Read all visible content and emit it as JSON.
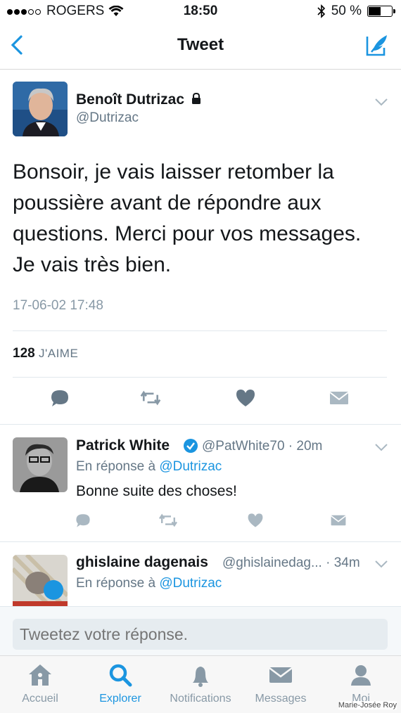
{
  "status_bar": {
    "carrier": "ROGERS",
    "time": "18:50",
    "battery": "50 %"
  },
  "nav": {
    "title": "Tweet"
  },
  "main_tweet": {
    "name": "Benoît Dutrizac",
    "handle": "@Dutrizac",
    "text": "Bonsoir, je vais laisser retomber la poussière avant de répondre aux questions. Merci pour vos messages. Je vais très bien.",
    "timestamp": "17-06-02 17:48",
    "likes_count": "128",
    "likes_label": "J'AIME"
  },
  "replies": [
    {
      "name": "Patrick White",
      "handle_time": "@PatWhite70 · 20m",
      "in_reply_prefix": "En réponse à",
      "in_reply_to": "@Dutrizac",
      "text": "Bonne suite des choses!"
    },
    {
      "name": "ghislaine dagenais",
      "handle_time": "@ghislainedag... · 34m",
      "in_reply_prefix": "En réponse à",
      "in_reply_to": "@Dutrizac"
    }
  ],
  "reply_bar": {
    "placeholder": "Tweetez votre réponse."
  },
  "tabs": [
    {
      "label": "Accueil",
      "icon": "home-icon"
    },
    {
      "label": "Explorer",
      "icon": "search-icon",
      "active": true
    },
    {
      "label": "Notifications",
      "icon": "bell-icon"
    },
    {
      "label": "Messages",
      "icon": "envelope-icon"
    },
    {
      "label": "Moi",
      "icon": "person-icon"
    }
  ],
  "credit": "Marie-Josée Roy",
  "colors": {
    "accent": "#1b95e0",
    "icon_gray": "#8899a6",
    "text": "#14171a"
  }
}
